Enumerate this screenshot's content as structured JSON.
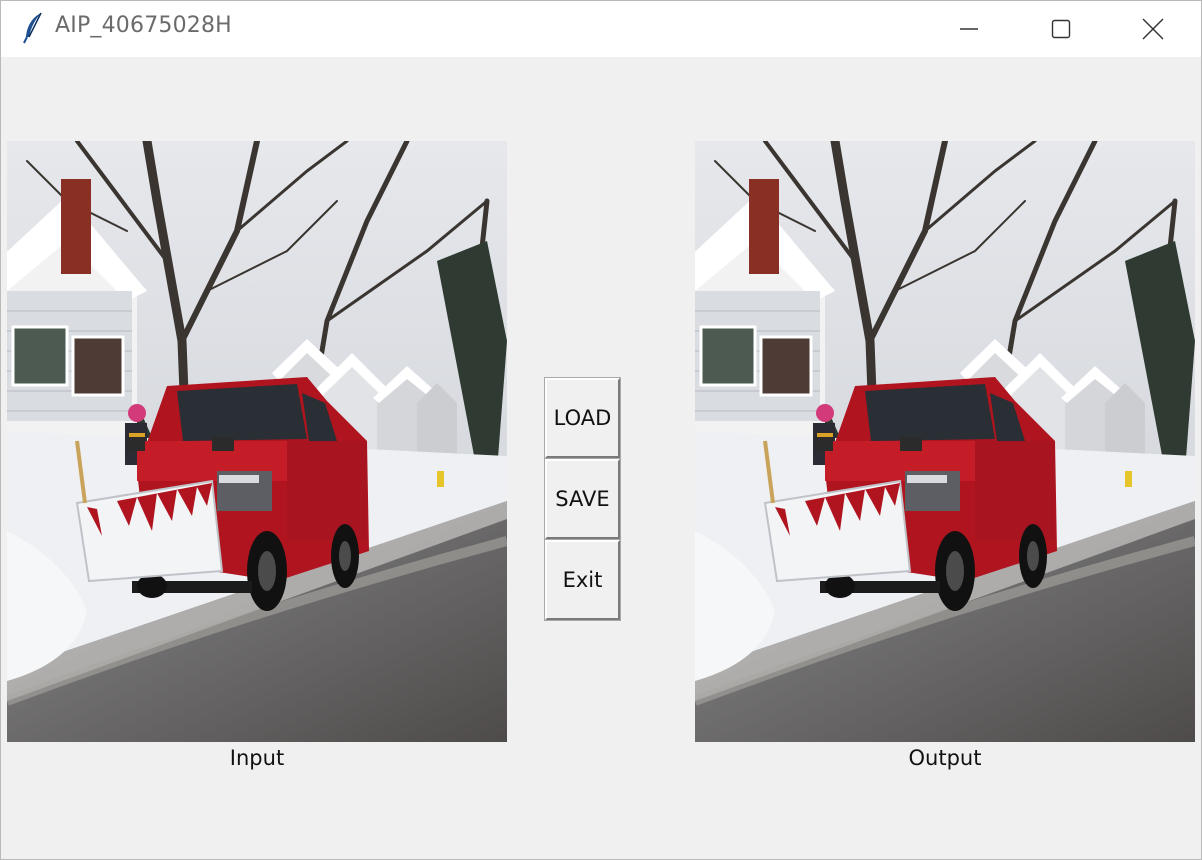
{
  "window": {
    "title": "AIP_40675028H"
  },
  "buttons": {
    "load": "LOAD",
    "save": "SAVE",
    "exit": "Exit"
  },
  "panels": {
    "input_label": "Input",
    "output_label": "Output"
  },
  "icons": {
    "app": "feather-icon",
    "minimize": "minimize-icon",
    "maximize": "maximize-icon",
    "close": "close-icon"
  },
  "colors": {
    "window_bg": "#f0f0f0",
    "titlebar_bg": "#ffffff",
    "truck_red": "#b0151f",
    "snow": "#eef0f3"
  }
}
